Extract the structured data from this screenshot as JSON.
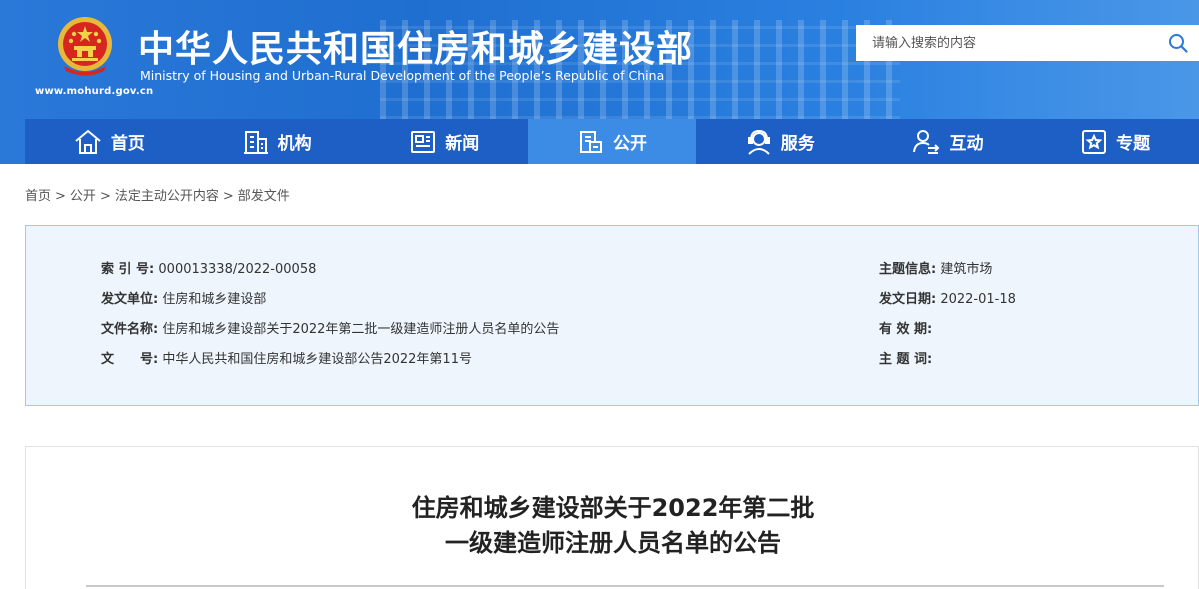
{
  "header": {
    "title_cn": "中华人民共和国住房和城乡建设部",
    "title_en": "Ministry of Housing and Urban-Rural Development of the People’s Republic of China",
    "site_url": "www.mohurd.gov.cn"
  },
  "search": {
    "placeholder": "请输入搜索的内容"
  },
  "nav": {
    "items": [
      {
        "label": "首页",
        "icon": "home-icon"
      },
      {
        "label": "机构",
        "icon": "building-icon"
      },
      {
        "label": "新闻",
        "icon": "newspaper-icon"
      },
      {
        "label": "公开",
        "icon": "public-docs-icon",
        "active": true
      },
      {
        "label": "服务",
        "icon": "service-agent-icon"
      },
      {
        "label": "互动",
        "icon": "interaction-icon"
      },
      {
        "label": "专题",
        "icon": "star-topic-icon"
      }
    ]
  },
  "breadcrumb": [
    "首页",
    "公开",
    "法定主动公开内容",
    "部发文件"
  ],
  "meta": {
    "index_label": "索 引 号:",
    "index_value": "000013338/2022-00058",
    "unit_label": "发文单位:",
    "unit_value": "住房和城乡建设部",
    "name_label": "文件名称:",
    "name_value": "住房和城乡建设部关于2022年第二批一级建造师注册人员名单的公告",
    "docno_label": "文　　号:",
    "docno_value": "中华人民共和国住房和城乡建设部公告2022年第11号",
    "topic_label": "主题信息:",
    "topic_value": "建筑市场",
    "date_label": "发文日期:",
    "date_value": "2022-01-18",
    "valid_label": "有 效 期:",
    "valid_value": "",
    "keywords_label": "主 题 词:",
    "keywords_value": ""
  },
  "article": {
    "title_line1": "住房和城乡建设部关于2022年第二批",
    "title_line2": "一级建造师注册人员名单的公告"
  },
  "colors": {
    "header_blue": "#2a78d8",
    "nav_blue": "#1e5fc6",
    "nav_active": "#3c8ce6",
    "meta_bg": "#eef5fc"
  }
}
